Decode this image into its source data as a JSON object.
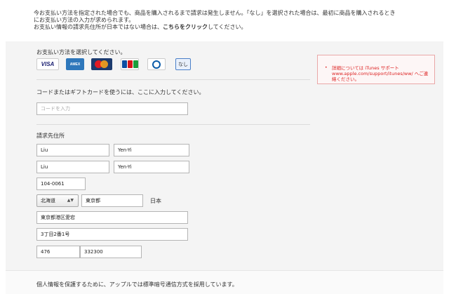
{
  "intro": {
    "line1": "今お支払い方法を指定された場合でも、商品を購入されるまで請求は発生しません。「なし」を選択された場合は、最初に商品を購入されるとき",
    "line2": "にお支払い方法の入力が求められます。",
    "line3_prefix": "お支払い情報の請求先住所が日本ではない場合は、",
    "line3_link": "こちらをクリック",
    "line3_suffix": "してください。"
  },
  "payment": {
    "heading": "お支払い方法を選択してください。",
    "cards": {
      "visa": "VISA",
      "amex": "AMEX",
      "none": "なし"
    }
  },
  "notice": {
    "bullet": "•",
    "text": "詳細については iTunes サポート www.apple.com/support/itunes/ww/ へご連絡ください。"
  },
  "gift": {
    "heading": "コードまたはギフトカードを使うには、ここに入力してください。",
    "placeholder": "コードを入力"
  },
  "billing": {
    "heading": "請求先住所",
    "first_name_1": "Liu",
    "last_name_1": "Yen-Yi",
    "first_name_2": "Liu",
    "last_name_2": "Yen-Yi",
    "postal_code": "104-0061",
    "prefecture": "北海道",
    "city": "東京都",
    "country": "日本",
    "address1": "東京都港区愛宕",
    "address2": "3丁目2番1号",
    "area_code": "476",
    "phone": "332300"
  },
  "footer": {
    "text": "個人情報を保護するために、アップルでは標準暗号通信方式を採用しています。"
  }
}
